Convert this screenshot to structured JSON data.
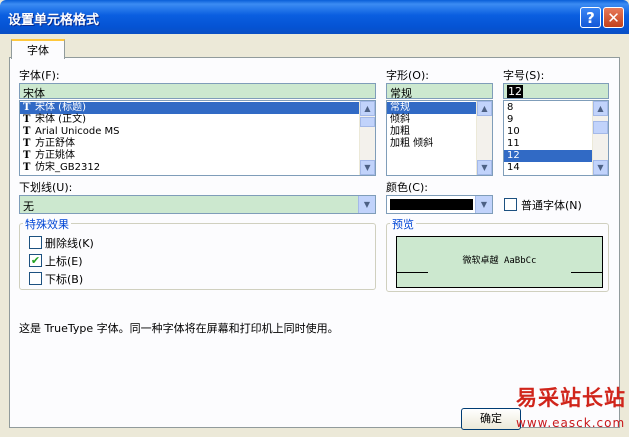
{
  "window": {
    "title": "设置单元格格式",
    "help_btn": "?",
    "close_btn": "✕"
  },
  "tabs": [
    {
      "label": "字体"
    }
  ],
  "font": {
    "label": "字体(F):",
    "value": "宋体",
    "items": [
      "宋体 (标题)",
      "宋体 (正文)",
      "Arial Unicode MS",
      "方正舒体",
      "方正姚体",
      "仿宋_GB2312"
    ],
    "selected_index": 0,
    "icon_glyph": "T"
  },
  "style": {
    "label": "字形(O):",
    "value": "常规",
    "items": [
      "常规",
      "倾斜",
      "加粗",
      "加粗 倾斜"
    ],
    "selected_index": 0
  },
  "size": {
    "label": "字号(S):",
    "value": "12",
    "items": [
      "8",
      "9",
      "10",
      "11",
      "12",
      "14"
    ],
    "selected_index": 4
  },
  "underline": {
    "label": "下划线(U):",
    "value": "无"
  },
  "color": {
    "label": "颜色(C):",
    "swatch": "#000000"
  },
  "normal_font": {
    "label": "普通字体(N)",
    "checked": false
  },
  "effects": {
    "label": "特殊效果",
    "strikethrough": {
      "label": "删除线(K)",
      "checked": false
    },
    "superscript": {
      "label": "上标(E)",
      "checked": true
    },
    "subscript": {
      "label": "下标(B)",
      "checked": false
    }
  },
  "preview": {
    "label": "预览",
    "sample": "微软卓越  AaBbCc"
  },
  "info": "这是 TrueType 字体。同一种字体将在屏幕和打印机上同时使用。",
  "ok_button": "确定",
  "watermark": {
    "line1": "易采站长站",
    "line2": "www.easck.com"
  }
}
